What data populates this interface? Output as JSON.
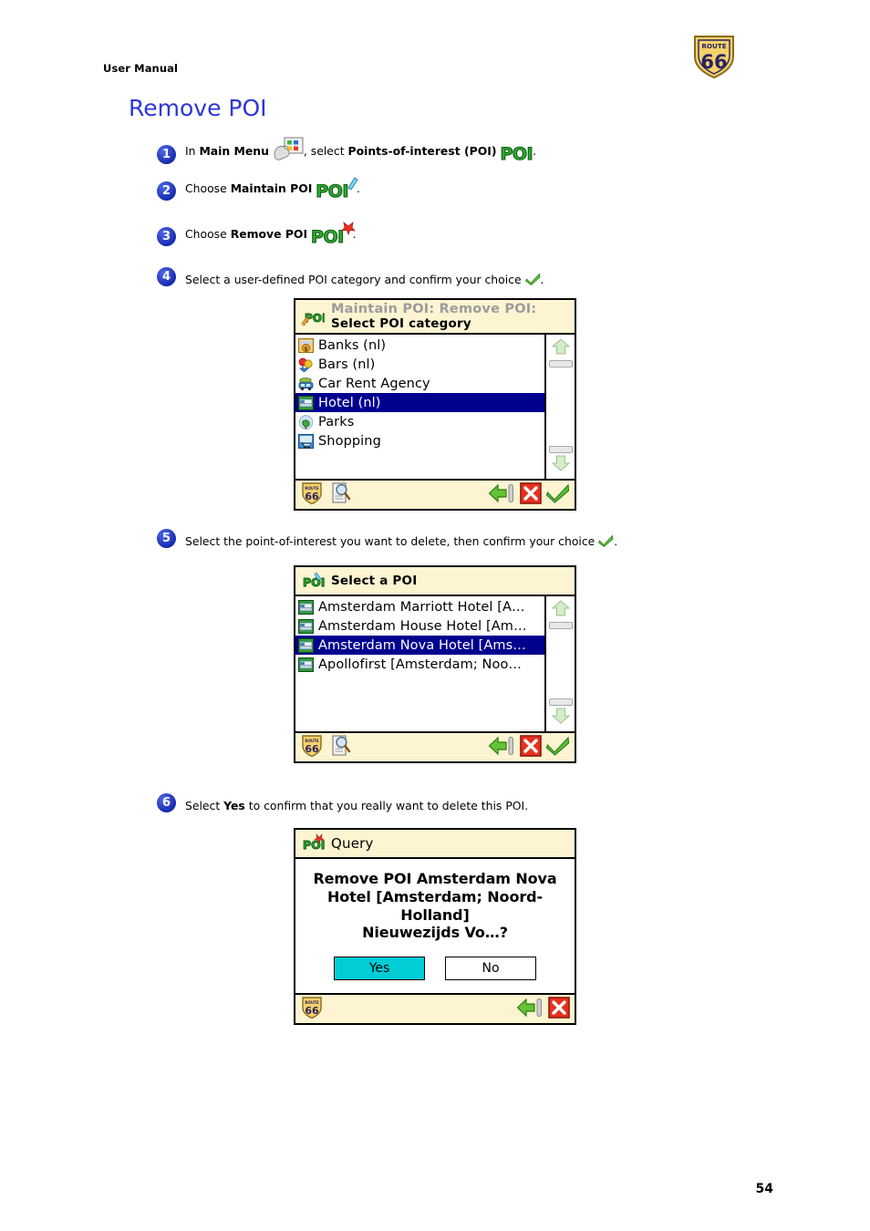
{
  "header": {
    "doc_label": "User Manual",
    "logo": {
      "top_text": "ROUTE",
      "number": "66"
    }
  },
  "section_title": "Remove POI",
  "steps": [
    {
      "number": "1",
      "parts": [
        "In ",
        "Main Menu",
        " , select ",
        "Points-of-interest (POI)",
        " ."
      ],
      "text_a": "In ",
      "bold_a": "Main Menu",
      "text_b": ", select ",
      "bold_b": "Points-of-interest (POI)",
      "text_c": "."
    },
    {
      "number": "2",
      "text_a": "Choose ",
      "bold_a": "Maintain POI",
      "text_c": "."
    },
    {
      "number": "3",
      "text_a": "Choose ",
      "bold_a": "Remove POI",
      "text_c": "."
    },
    {
      "number": "4",
      "text_a": "Select a user-defined POI category and confirm your choice ",
      "text_c": "."
    },
    {
      "number": "5",
      "text_a": "Select the point-of-interest you want to delete, then confirm your choice ",
      "text_c": "."
    },
    {
      "number": "6",
      "text_a": "Select ",
      "bold_a": "Yes",
      "text_b": " to confirm that you really want to delete this POI.",
      "text_c": ""
    }
  ],
  "screen_category": {
    "title_line1": "Maintain POI: Remove POI:",
    "title_line2": "Select POI category",
    "items": [
      {
        "label": "Banks  (nl)",
        "icon": "bank-icon",
        "selected": false
      },
      {
        "label": "Bars  (nl)",
        "icon": "bar-icon",
        "selected": false
      },
      {
        "label": "Car  Rent  Agency",
        "icon": "car-rental-icon",
        "selected": false
      },
      {
        "label": "Hotel (nl)",
        "icon": "hotel-icon",
        "selected": true
      },
      {
        "label": "Parks",
        "icon": "park-icon",
        "selected": false
      },
      {
        "label": "Shopping",
        "icon": "shopping-icon",
        "selected": false
      }
    ],
    "toolbar": {
      "logo": "route66-logo-icon",
      "search": "search-document-icon",
      "back": "back-arrow-icon",
      "cancel": "cancel-icon",
      "confirm": "confirm-check-icon"
    }
  },
  "screen_poi": {
    "title_single": "Select a POI",
    "items": [
      {
        "label": "Amsterdam Marriott Hotel [A…",
        "icon": "hotel-icon",
        "selected": false
      },
      {
        "label": "Amsterdam House Hotel [Am…",
        "icon": "hotel-icon",
        "selected": false
      },
      {
        "label": "Amsterdam Nova Hotel [Ams…",
        "icon": "hotel-icon",
        "selected": true
      },
      {
        "label": "Apollofirst [Amsterdam; Noo…",
        "icon": "hotel-icon",
        "selected": false
      }
    ],
    "toolbar": {
      "logo": "route66-logo-icon",
      "search": "search-document-icon",
      "back": "back-arrow-icon",
      "cancel": "cancel-icon",
      "confirm": "confirm-check-icon"
    }
  },
  "screen_query": {
    "title_single": "Query",
    "message_lines": [
      "Remove POI Amsterdam Nova",
      "Hotel [Amsterdam; Noord-",
      "Holland]",
      "Nieuwezijds Vo…?"
    ],
    "message": "Remove POI Amsterdam Nova Hotel [Amsterdam; Noord-Holland] Nieuwezijds Vo…?",
    "buttons": {
      "yes": "Yes",
      "no": "No"
    },
    "toolbar": {
      "logo": "route66-logo-icon",
      "back": "back-arrow-icon",
      "cancel": "cancel-icon"
    }
  },
  "page_number": "54",
  "colors": {
    "heading": "#2d36d8",
    "step_badge": "#1b35c4",
    "titlebar_bg": "#fdf4d2",
    "selection_bg": "#00008f",
    "yes_button_bg": "#00cdd6",
    "poi_green": "#2faa2f",
    "logo_yellow": "#f5d16b",
    "logo_navy": "#2b2360",
    "cancel_red": "#e8301e"
  }
}
